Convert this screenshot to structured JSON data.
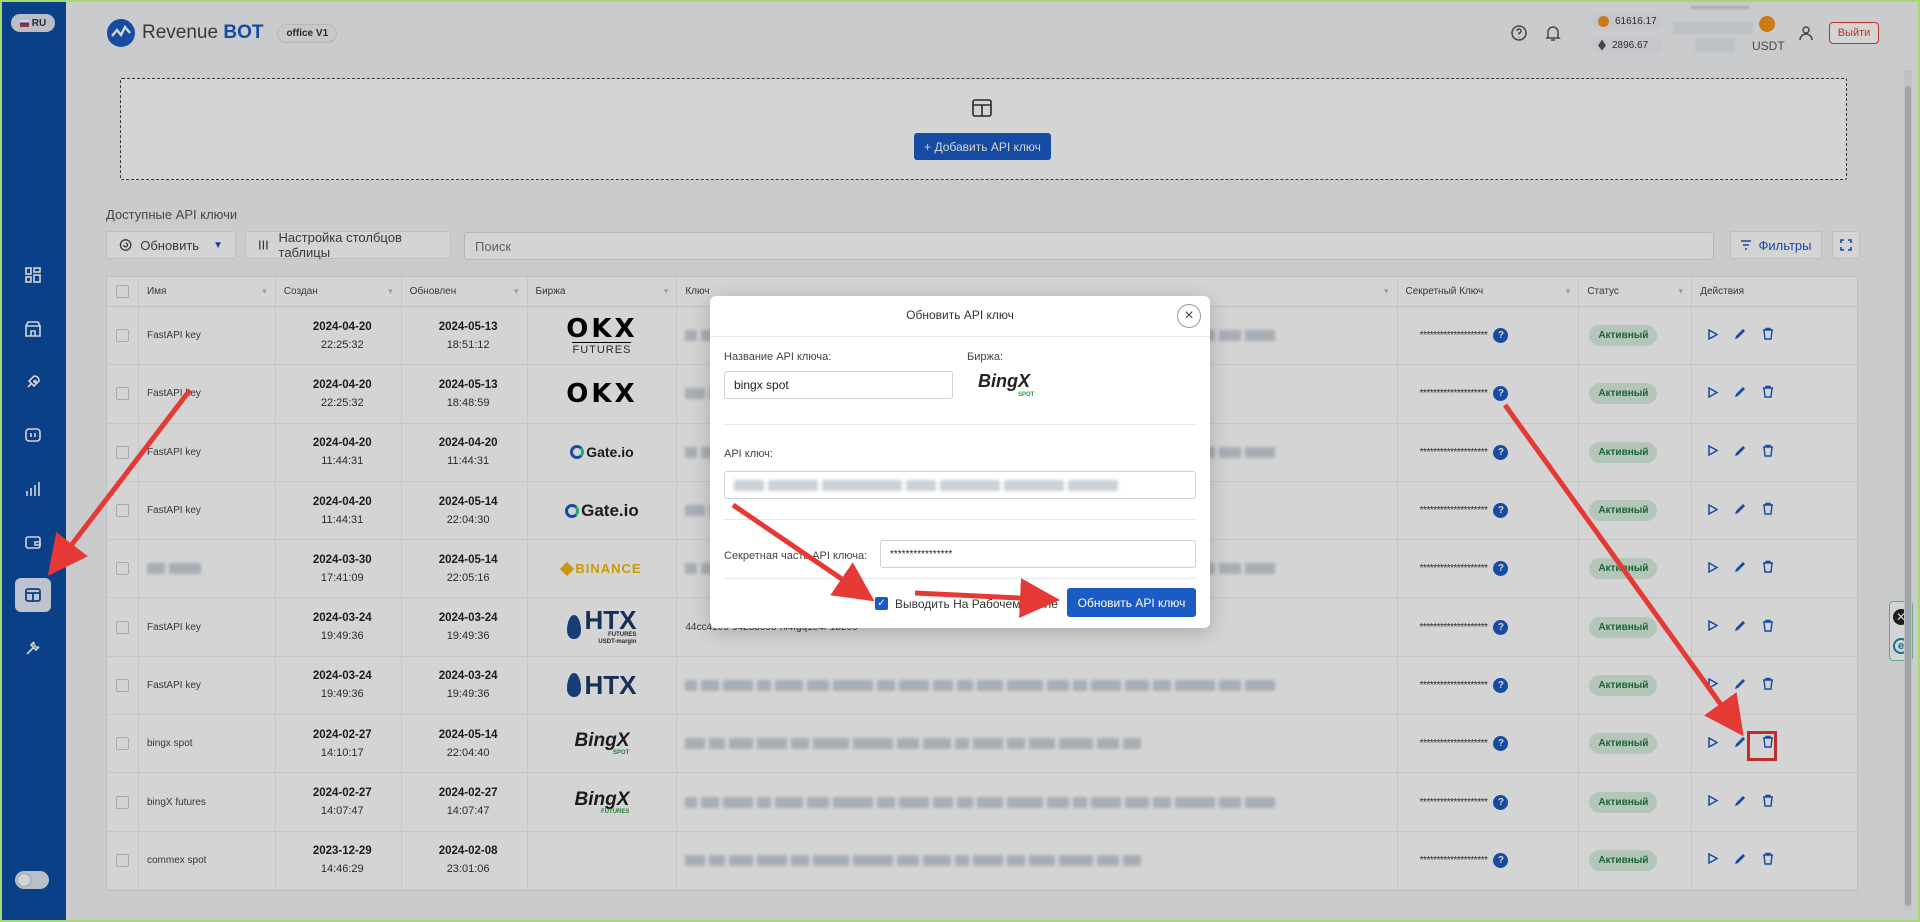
{
  "sidebar": {
    "lang": "RU"
  },
  "header": {
    "brand_regular": "Revenue",
    "brand_bold": "BOT",
    "version": "office V1",
    "btc_price": "61616.17",
    "eth_price": "2896.67",
    "currency": "USDT",
    "logout": "Выйти"
  },
  "add_panel": {
    "button": "+ Добавить API ключ"
  },
  "section_title": "Доступные API ключи",
  "toolbar": {
    "refresh": "Обновить",
    "columns": "Настройка столбцов таблицы",
    "search_placeholder": "Поиск",
    "filters": "Фильтры"
  },
  "table": {
    "headers": [
      "Имя",
      "Создан",
      "Обновлен",
      "Биржа",
      "Ключ",
      "Секретный Ключ",
      "Статус",
      "Действия"
    ],
    "secret_mask": "********************",
    "status": "Активный",
    "rows": [
      {
        "name": "FastAPI key",
        "created_date": "2024-04-20",
        "created_time": "22:25:32",
        "updated_date": "2024-05-13",
        "updated_time": "18:51:12",
        "exchange": "OKX",
        "exchange_sub": "FUTURES",
        "key": ""
      },
      {
        "name": "FastAPI key",
        "created_date": "2024-04-20",
        "created_time": "22:25:32",
        "updated_date": "2024-05-13",
        "updated_time": "18:48:59",
        "exchange": "OKX",
        "exchange_sub": "",
        "key": ""
      },
      {
        "name": "FastAPI key",
        "created_date": "2024-04-20",
        "created_time": "11:44:31",
        "updated_date": "2024-04-20",
        "updated_time": "11:44:31",
        "exchange": "Gate.io",
        "exchange_sub": "",
        "key": ""
      },
      {
        "name": "FastAPI key",
        "created_date": "2024-04-20",
        "created_time": "11:44:31",
        "updated_date": "2024-05-14",
        "updated_time": "22:04:30",
        "exchange": "Gate.io",
        "exchange_sub": "",
        "key": ""
      },
      {
        "name": "",
        "created_date": "2024-03-30",
        "created_time": "17:41:09",
        "updated_date": "2024-05-14",
        "updated_time": "22:05:16",
        "exchange": "BINANCE",
        "exchange_sub": "",
        "key": ""
      },
      {
        "name": "FastAPI key",
        "created_date": "2024-03-24",
        "created_time": "19:49:36",
        "updated_date": "2024-03-24",
        "updated_time": "19:49:36",
        "exchange": "HTX",
        "exchange_sub": "FUTURES USDT-margin",
        "key": "44cc41e6-9423309b-nl4fgq1e4f-1b209"
      },
      {
        "name": "FastAPI key",
        "created_date": "2024-03-24",
        "created_time": "19:49:36",
        "updated_date": "2024-03-24",
        "updated_time": "19:49:36",
        "exchange": "HTX",
        "exchange_sub": "",
        "key": ""
      },
      {
        "name": "bingx spot",
        "created_date": "2024-02-27",
        "created_time": "14:10:17",
        "updated_date": "2024-05-14",
        "updated_time": "22:04:40",
        "exchange": "BingX",
        "exchange_sub": "SPOT",
        "key": ""
      },
      {
        "name": "bingX futures",
        "created_date": "2024-02-27",
        "created_time": "14:07:47",
        "updated_date": "2024-02-27",
        "updated_time": "14:07:47",
        "exchange": "BingX",
        "exchange_sub": "FUTURES",
        "key": ""
      },
      {
        "name": "commex spot",
        "created_date": "2023-12-29",
        "created_time": "14:46:29",
        "updated_date": "2024-02-08",
        "updated_time": "23:01:06",
        "exchange": "",
        "exchange_sub": "",
        "key": ""
      }
    ]
  },
  "modal": {
    "title": "Обновить API ключ",
    "name_label": "Название API ключа:",
    "name_value": "bingx spot",
    "exchange_label": "Биржа:",
    "exchange_name": "BingX",
    "exchange_sub": "SPOT",
    "api_key_label": "API ключ:",
    "secret_label": "Секретная часть API ключа:",
    "secret_value": "****************",
    "checkbox_label": "Выводить На Рабочем Столе",
    "submit": "Обновить API ключ"
  },
  "colors": {
    "primary": "#1a5bc4",
    "sidebar": "#0d4da3",
    "annotation": "#e53935",
    "status_bg": "#d9efe0"
  }
}
